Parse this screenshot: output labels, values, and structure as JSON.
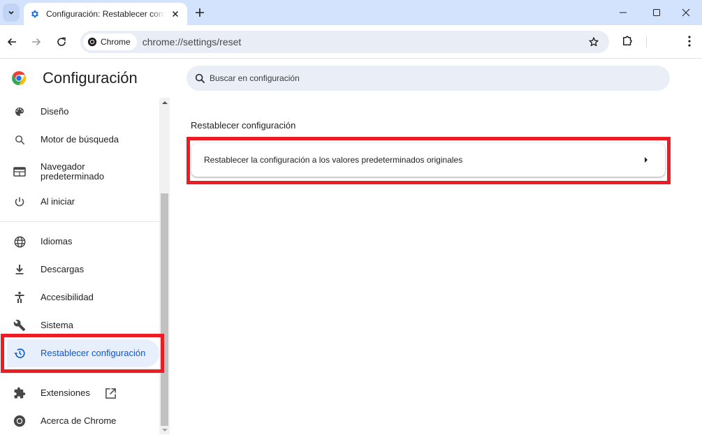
{
  "browser": {
    "tab_title": "Configuración: Restablecer configuración",
    "url_chip": "Chrome",
    "url": "chrome://settings/reset"
  },
  "settings": {
    "app_title": "Configuración",
    "search_placeholder": "Buscar en configuración",
    "sidebar": {
      "items": [
        {
          "label": "Diseño",
          "icon": "palette-icon"
        },
        {
          "label": "Motor de búsqueda",
          "icon": "search-icon"
        },
        {
          "label": "Navegador predeterminado",
          "icon": "browser-window-icon"
        },
        {
          "label": "Al iniciar",
          "icon": "power-icon"
        },
        {
          "label": "Idiomas",
          "icon": "globe-icon"
        },
        {
          "label": "Descargas",
          "icon": "download-icon"
        },
        {
          "label": "Accesibilidad",
          "icon": "accessibility-icon"
        },
        {
          "label": "Sistema",
          "icon": "wrench-icon"
        },
        {
          "label": "Restablecer configuración",
          "icon": "restore-history-icon",
          "active": true
        },
        {
          "label": "Extensiones",
          "icon": "puzzle-icon"
        },
        {
          "label": "Acerca de Chrome",
          "icon": "chrome-icon"
        }
      ]
    },
    "main": {
      "section_title": "Restablecer configuración",
      "reset_row_label": "Restablecer la configuración a los valores predeterminados originales"
    }
  },
  "colors": {
    "accent": "#0b57d0",
    "highlight_box": "#ed1c24",
    "titlebar": "#d3e3fd"
  }
}
